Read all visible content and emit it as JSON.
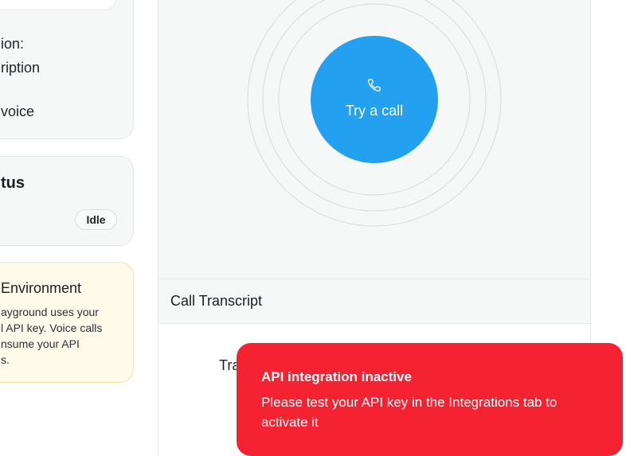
{
  "config_card": {
    "line1": "ion:",
    "line2": "ription",
    "line3": "voice"
  },
  "status_card": {
    "title": "tus",
    "badge": "Idle"
  },
  "environment_card": {
    "title": "Environment",
    "body": "ayground uses your\nl API key. Voice calls\nnsume your API\ns."
  },
  "call": {
    "button_label": "Try a call",
    "icon": "phone-icon"
  },
  "transcript": {
    "title": "Call Transcript",
    "placeholder": "Tra"
  },
  "toast": {
    "title": "API integration inactive",
    "message": "Please test your API key in the Integrations tab to activate it"
  },
  "colors": {
    "accent_blue": "#23a0f0",
    "toast_red": "#f52232",
    "panel_bg": "#f6f7f7",
    "warning_bg": "#fffbea",
    "warning_border": "#f6e3a2"
  }
}
